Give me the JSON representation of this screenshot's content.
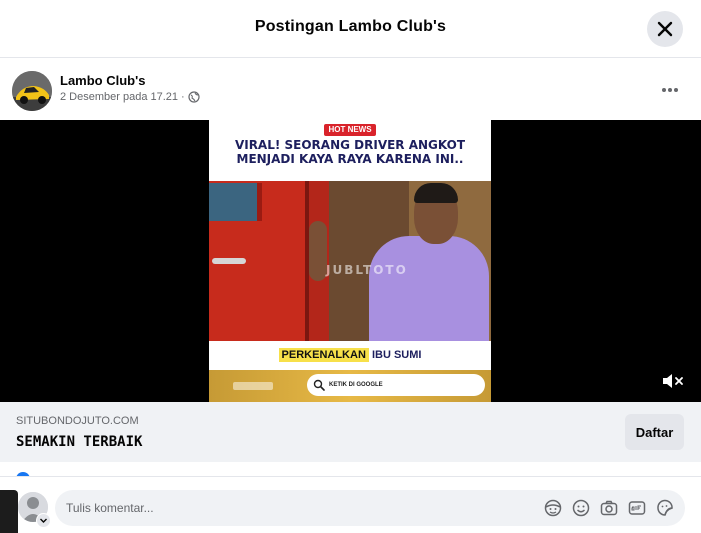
{
  "dialog": {
    "title": "Postingan Lambo Club's"
  },
  "post": {
    "author": "Lambo Club's",
    "timestamp": "2 Desember pada 17.21",
    "dot": "·"
  },
  "video": {
    "badge_hot": "HOT",
    "badge_news": "NEWS",
    "headline_line1": "VIRAL! SEORANG DRIVER ANGKOT",
    "headline_line2": "MENJADI KAYA RAYA KARENA INI..",
    "watermark": "JUBLTOTO",
    "caption_highlight": "PERKENALKAN",
    "caption_rest": "IBU SUMI",
    "search_text": "KETIK DI GOOGLE"
  },
  "ad": {
    "domain": "SITUBONDOJUTO.COM",
    "title": "SEMAKIN TERBAIK",
    "button_label": "Daftar"
  },
  "comment": {
    "placeholder": "Tulis komentar..."
  },
  "colors": {
    "facebook_blue": "#1877f2",
    "hot_red": "#d9232b",
    "headline_navy": "#1d1f5e"
  },
  "icons": {
    "close": "close-icon",
    "more": "more-options-icon",
    "globe": "globe-icon",
    "mute": "volume-muted-icon",
    "avatar_sticker": "avatar-sticker-icon",
    "emoji": "emoji-icon",
    "camera": "camera-icon",
    "gif": "gif-icon",
    "sticker": "sticker-icon"
  }
}
